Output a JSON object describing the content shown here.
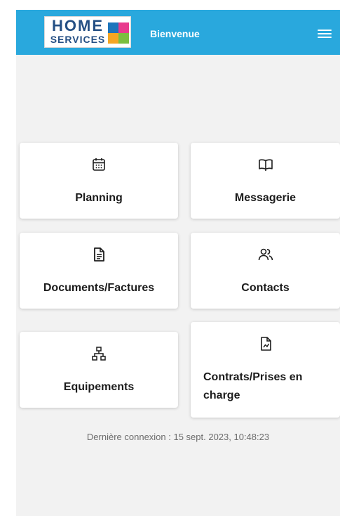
{
  "header": {
    "logo_line1": "HOME",
    "logo_line2": "SERVICES",
    "title": "Bienvenue",
    "menu_icon": "hamburger-menu-icon",
    "background": "#29a8dd"
  },
  "tiles": [
    {
      "label": "Planning",
      "icon": "calendar-icon"
    },
    {
      "label": "Messagerie",
      "icon": "open-book-icon"
    },
    {
      "label": "Documents/Factures",
      "icon": "document-icon"
    },
    {
      "label": "Contacts",
      "icon": "users-icon"
    },
    {
      "label": "Equipements",
      "icon": "network-sitemap-icon"
    },
    {
      "label": "Contrats/Prises en charge",
      "icon": "file-chart-icon"
    }
  ],
  "footer": {
    "last_login": "Dernière connexion : 15 sept. 2023, 10:48:23"
  }
}
